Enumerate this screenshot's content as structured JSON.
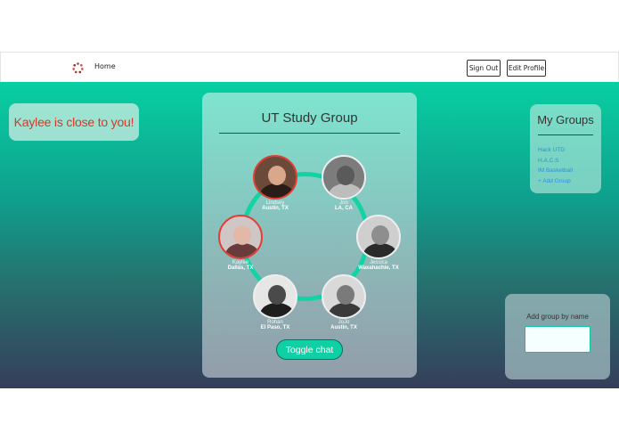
{
  "nav": {
    "home_label": "Home",
    "signout_label": "Sign Out",
    "edit_profile_label": "Edit Profile"
  },
  "toast": {
    "text": "Kaylee is close to you!"
  },
  "group": {
    "title": "UT Study Group",
    "members": [
      {
        "name": "Lindsey",
        "location": "Austin, TX"
      },
      {
        "name": "Jon",
        "location": "LA, CA"
      },
      {
        "name": "Jessica",
        "location": "Waxahachie, TX"
      },
      {
        "name": "JoJo",
        "location": "Austin, TX"
      },
      {
        "name": "Rohan",
        "location": "El Paso, TX"
      },
      {
        "name": "Kaylee",
        "location": "Dallas, TX"
      }
    ],
    "toggle_chat_label": "Toggle chat"
  },
  "my_groups": {
    "title": "My Groups",
    "items": [
      "Hack UTD",
      "H.A.C.S",
      "IM Basketball",
      "+ Add Group"
    ]
  },
  "add_group": {
    "label": "Add group by name",
    "value": ""
  },
  "colors": {
    "accent": "#12d3a4",
    "alert": "#d23a2a",
    "link": "#2d8fd5"
  }
}
